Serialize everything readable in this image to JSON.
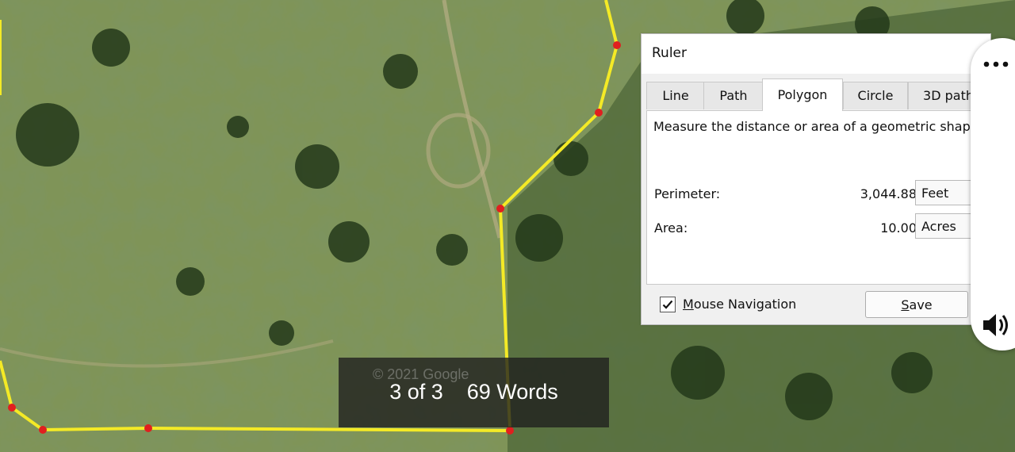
{
  "map": {
    "watermark": "© 2021 Google"
  },
  "ruler": {
    "title": "Ruler",
    "tabs": [
      {
        "label": "Line",
        "active": false
      },
      {
        "label": "Path",
        "active": false
      },
      {
        "label": "Polygon",
        "active": true
      },
      {
        "label": "Circle",
        "active": false
      },
      {
        "label": "3D path",
        "active": false
      }
    ],
    "description": "Measure the distance or area of a geometric shape",
    "perimeter": {
      "label": "Perimeter:",
      "value": "3,044.88",
      "unit": "Feet"
    },
    "area": {
      "label": "Area:",
      "value": "10.00",
      "unit": "Acres"
    },
    "mouse_navigation": {
      "label": "Mouse Navigation",
      "checked": true
    },
    "save_label": "Save"
  },
  "caption": {
    "text": "3 of 3    69 Words"
  },
  "side_panel": {
    "icons": [
      "more-icon",
      "speaker-icon"
    ]
  },
  "colors": {
    "polygon_line": "#f4ea26",
    "vertex": "#e01f1f"
  }
}
